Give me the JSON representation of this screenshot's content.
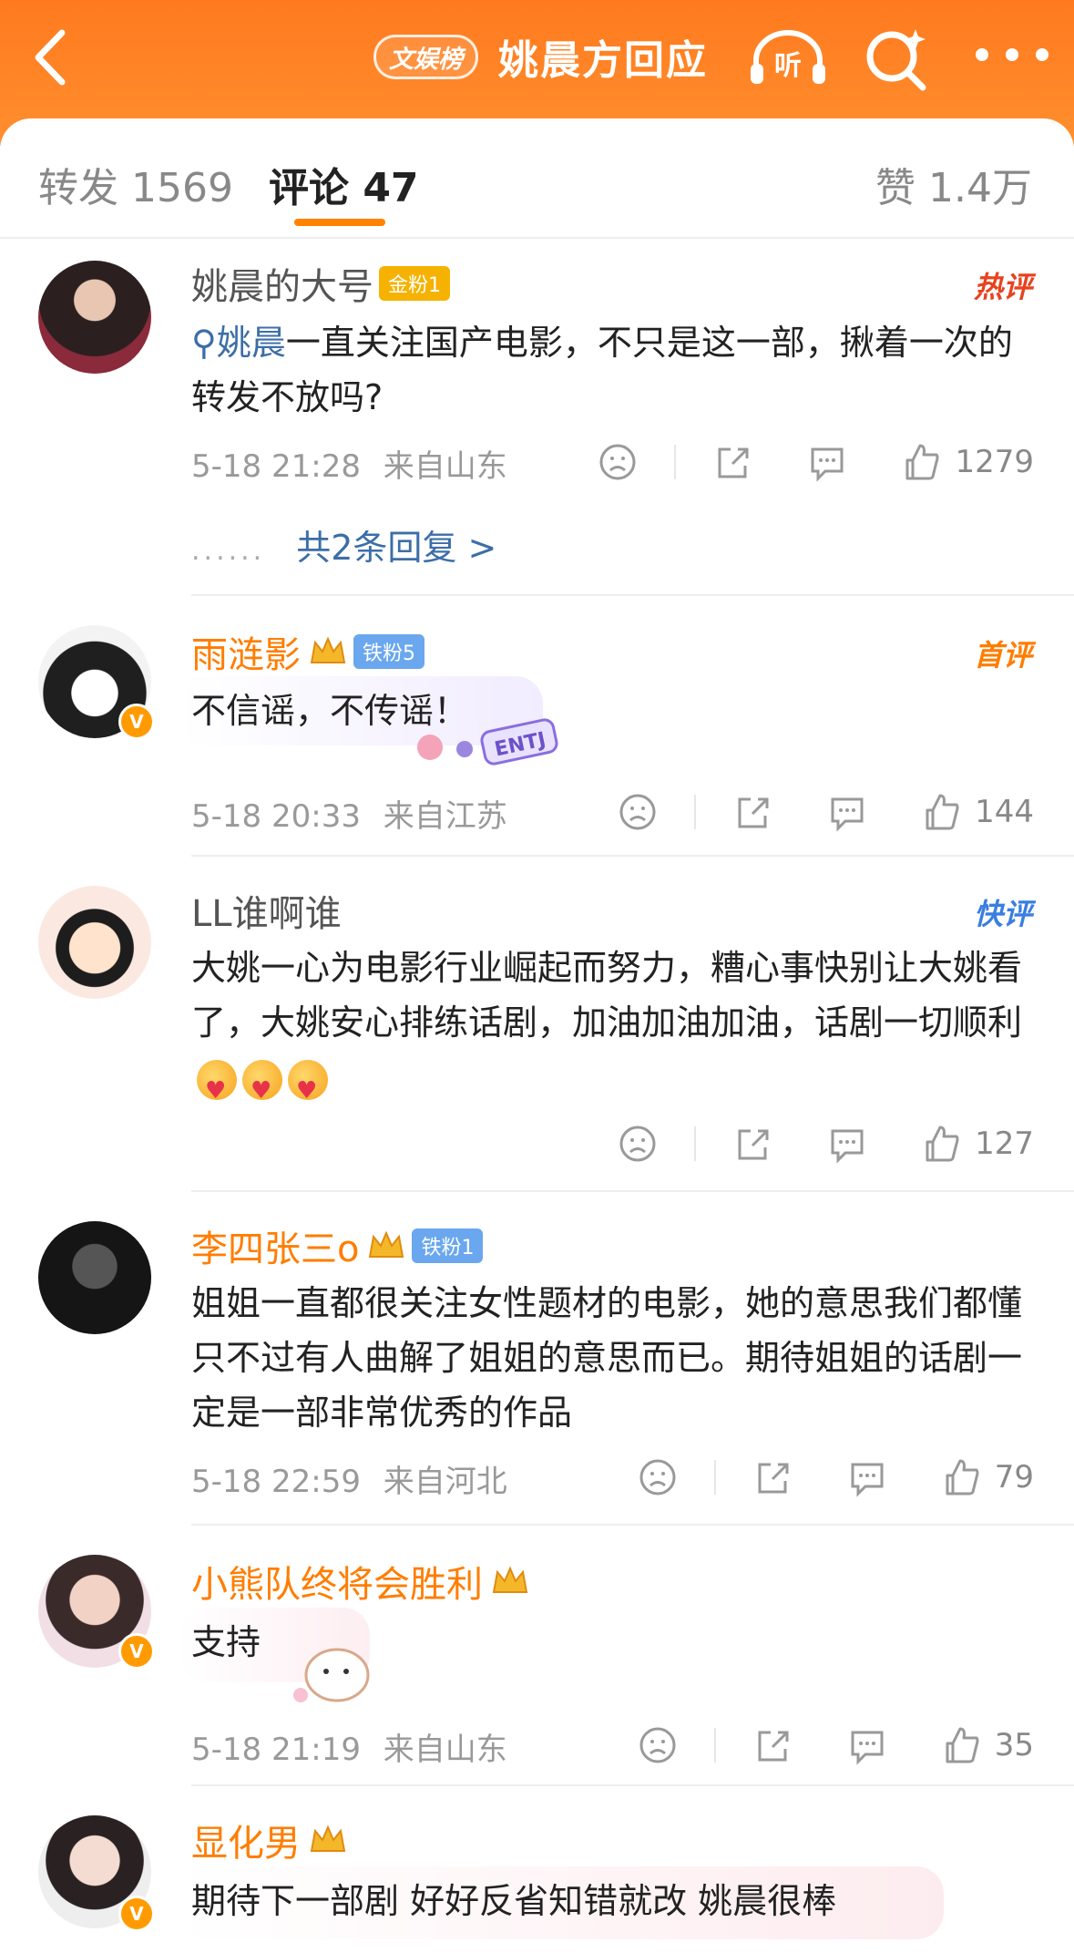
{
  "header": {
    "topic_badge": "文娱榜",
    "title": "姚晨方回应"
  },
  "tabs": {
    "repost": "转发 1569",
    "comments": "评论 47",
    "likes": "赞 1.4万"
  },
  "comments": [
    {
      "username": "姚晨的大号",
      "fan_badge": "金粉1",
      "tag": "热评",
      "mention": "姚晨",
      "text": "一直关注国产电影，不只是这一部，揪着一次的转发不放吗?",
      "time": "5-18 21:28",
      "location": "来自山东",
      "likes": "1279",
      "replies": "共2条回复 >"
    },
    {
      "username": "雨涟影",
      "fan_badge": "铁粉5",
      "tag": "首评",
      "text": "不信谣，不传谣！",
      "time": "5-18 20:33",
      "location": "来自江苏",
      "likes": "144"
    },
    {
      "username": "LL谁啊谁",
      "tag": "快评",
      "text": "大姚一心为电影行业崛起而努力，糟心事快别让大姚看了，大姚安心排练话剧，加油加油加油，话剧一切顺利",
      "likes": "127"
    },
    {
      "username": "李四张三o",
      "fan_badge": "铁粉1",
      "text": "姐姐一直都很关注女性题材的电影，她的意思我们都懂只不过有人曲解了姐姐的意思而已。期待姐姐的话剧一定是一部非常优秀的作品",
      "time": "5-18 22:59",
      "location": "来自河北",
      "likes": "79"
    },
    {
      "username": "小熊队终将会胜利",
      "text": "支持",
      "time": "5-18 21:19",
      "location": "来自山东",
      "likes": "35"
    },
    {
      "username": "显化男",
      "text": "期待下一部剧 好好反省知错就改 姚晨很棒"
    }
  ],
  "colors": {
    "header": "#ff7a1f",
    "accent": "#ff8200",
    "link": "#3c6ea8",
    "hot": "#e8421e",
    "first": "#ff7d00",
    "fast": "#3a7ee0"
  }
}
